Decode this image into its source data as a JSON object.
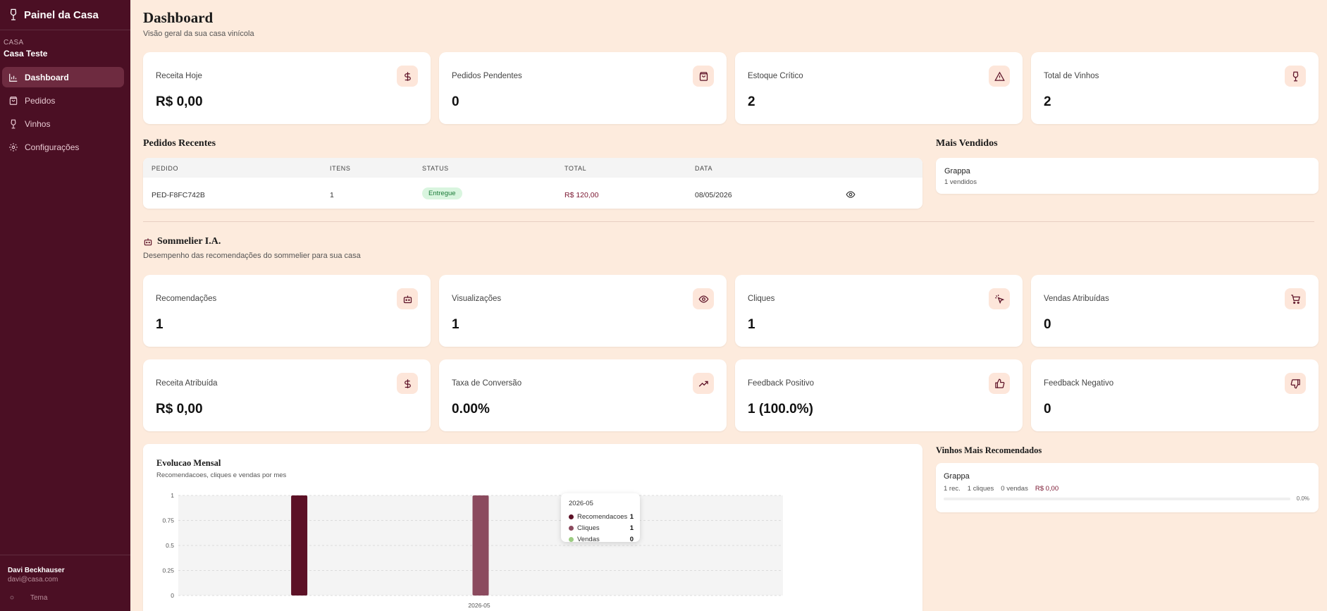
{
  "sidebar": {
    "brand": "Painel da Casa",
    "house_label": "CASA",
    "house_name": "Casa Teste",
    "items": [
      {
        "label": "Dashboard",
        "icon": "bar-chart-icon",
        "active": true
      },
      {
        "label": "Pedidos",
        "icon": "shopping-bag-icon",
        "active": false
      },
      {
        "label": "Vinhos",
        "icon": "wine-glass-icon",
        "active": false
      },
      {
        "label": "Configurações",
        "icon": "gear-icon",
        "active": false
      }
    ],
    "user_name": "Davi Beckhauser",
    "user_email": "davi@casa.com",
    "theme_label": "Tema"
  },
  "header": {
    "title": "Dashboard",
    "subtitle": "Visão geral da sua casa vinícola"
  },
  "stats_top": [
    {
      "label": "Receita Hoje",
      "value": "R$ 0,00",
      "icon": "dollar-icon"
    },
    {
      "label": "Pedidos Pendentes",
      "value": "0",
      "icon": "shopping-bag-icon"
    },
    {
      "label": "Estoque Crítico",
      "value": "2",
      "icon": "alert-triangle-icon"
    },
    {
      "label": "Total de Vinhos",
      "value": "2",
      "icon": "wine-glass-icon"
    }
  ],
  "recent_orders": {
    "title": "Pedidos Recentes",
    "columns": [
      "PEDIDO",
      "ITENS",
      "STATUS",
      "TOTAL",
      "DATA"
    ],
    "rows": [
      {
        "pedido": "PED-F8FC742B",
        "itens": "1",
        "status": "Entregue",
        "total": "R$ 120,00",
        "data": "08/05/2026"
      }
    ]
  },
  "best_sellers": {
    "title": "Mais Vendidos",
    "items": [
      {
        "name": "Grappa",
        "sub": "1 vendidos"
      }
    ]
  },
  "sommelier": {
    "title": "Sommelier I.A.",
    "subtitle": "Desempenho das recomendações do sommelier para sua casa",
    "stats_row1": [
      {
        "label": "Recomendações",
        "value": "1",
        "icon": "robot-icon"
      },
      {
        "label": "Visualizações",
        "value": "1",
        "icon": "eye-icon"
      },
      {
        "label": "Cliques",
        "value": "1",
        "icon": "pointer-click-icon"
      },
      {
        "label": "Vendas Atribuídas",
        "value": "0",
        "icon": "cart-icon"
      }
    ],
    "stats_row2": [
      {
        "label": "Receita Atribuída",
        "value": "R$ 0,00",
        "icon": "dollar-icon"
      },
      {
        "label": "Taxa de Conversão",
        "value": "0.00%",
        "icon": "trending-up-icon"
      },
      {
        "label": "Feedback Positivo",
        "value": "1 (100.0%)",
        "icon": "thumbs-up-icon"
      },
      {
        "label": "Feedback Negativo",
        "value": "0",
        "icon": "thumbs-down-icon"
      }
    ]
  },
  "chart": {
    "title": "Evolucao Mensal",
    "subtitle": "Recomendacoes, cliques e vendas por mes",
    "tooltip": {
      "title": "2026-05",
      "rows": [
        {
          "name": "Recomendacoes",
          "value": "1",
          "color": "#5c1126"
        },
        {
          "name": "Cliques",
          "value": "1",
          "color": "#8b4a5e"
        },
        {
          "name": "Vendas",
          "value": "0",
          "color": "#9ccc82"
        }
      ]
    }
  },
  "chart_data": {
    "type": "bar",
    "categories": [
      "2026-05"
    ],
    "series": [
      {
        "name": "Recomendacoes",
        "values": [
          1
        ],
        "color": "#5c1126"
      },
      {
        "name": "Cliques",
        "values": [
          1
        ],
        "color": "#8b4a5e"
      },
      {
        "name": "Vendas",
        "values": [
          0
        ],
        "color": "#9ccc82"
      }
    ],
    "yticks": [
      "0",
      "0.25",
      "0.5",
      "0.75",
      "1"
    ],
    "ylim": [
      0,
      1
    ],
    "grid": true
  },
  "recommended_wines": {
    "title": "Vinhos Mais Recomendados",
    "items": [
      {
        "name": "Grappa",
        "recs": "1 rec.",
        "clicks": "1 cliques",
        "sales": "0 vendas",
        "revenue": "R$ 0,00",
        "pct": "0.0%",
        "progress": 0
      }
    ]
  },
  "colors": {
    "sidebar_bg": "#4b0f24",
    "page_bg": "#fdebdd",
    "accent": "#7a1630",
    "badge_bg": "#d9f5df"
  }
}
